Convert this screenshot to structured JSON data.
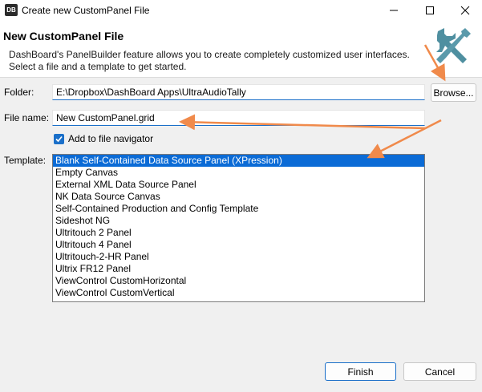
{
  "window": {
    "app_icon_text": "DB",
    "title": "Create new CustomPanel File"
  },
  "header": {
    "title": "New CustomPanel File",
    "description_line1": "DashBoard's PanelBuilder feature allows you to create completely customized user interfaces.",
    "description_line2": "Select a file and a template to get started.",
    "icon": "tools-icon"
  },
  "form": {
    "folder_label": "Folder:",
    "folder_value": "E:\\Dropbox\\DashBoard Apps\\UltraAudioTally",
    "browse_label": "Browse...",
    "filename_label": "File name:",
    "filename_value": "New CustomPanel.grid",
    "checkbox_label": "Add to file navigator",
    "checkbox_checked": true,
    "template_label": "Template:",
    "templates": [
      "Blank Self-Contained Data Source Panel (XPression)",
      "Empty Canvas",
      "External XML Data Source Panel",
      "NK Data Source Canvas",
      "Self-Contained Production and Config Template",
      "Sideshot NG",
      "Ultritouch 2 Panel",
      "Ultritouch 4 Panel",
      "Ultritouch-2-HR Panel",
      "Ultrix FR12 Panel",
      "ViewControl CustomHorizontal",
      "ViewControl CustomVertical"
    ],
    "selected_template": 0
  },
  "footer": {
    "finish_label": "Finish",
    "cancel_label": "Cancel"
  },
  "colors": {
    "accent": "#1a6fc9",
    "selection": "#0b6bd6",
    "annotation_arrow": "#f08a4b",
    "tools_icon": "#4f8fa0"
  }
}
